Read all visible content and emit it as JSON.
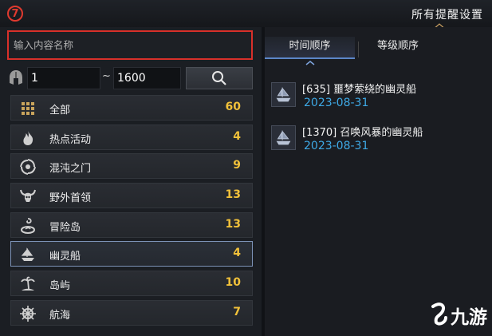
{
  "step_number": "7",
  "title": "所有提醒设置",
  "search": {
    "placeholder": "输入内容名称"
  },
  "level_filter": {
    "min": "1",
    "separator": "~",
    "max": "1600"
  },
  "categories": [
    {
      "label": "全部",
      "count": "60",
      "icon": "grid-icon"
    },
    {
      "label": "热点活动",
      "count": "4",
      "icon": "flame-icon"
    },
    {
      "label": "混沌之门",
      "count": "9",
      "icon": "vortex-icon"
    },
    {
      "label": "野外首领",
      "count": "13",
      "icon": "horned-skull-icon"
    },
    {
      "label": "冒险岛",
      "count": "13",
      "icon": "swirl-island-icon"
    },
    {
      "label": "幽灵船",
      "count": "4",
      "icon": "ship-icon"
    },
    {
      "label": "岛屿",
      "count": "10",
      "icon": "palm-island-icon"
    },
    {
      "label": "航海",
      "count": "7",
      "icon": "ship-wheel-icon"
    }
  ],
  "tabs": {
    "time": "时间顺序",
    "level": "等级顺序"
  },
  "reminders": [
    {
      "title": "[635] 噩梦萦绕的幽灵船",
      "date": "2023-08-31"
    },
    {
      "title": "[1370] 召唤风暴的幽灵船",
      "date": "2023-08-31"
    }
  ],
  "watermark": "九游",
  "colors": {
    "accent_red": "#e03a2f",
    "count_gold": "#f1c13a",
    "date_blue": "#3ea9e6",
    "selected_border": "#7d93b8"
  }
}
